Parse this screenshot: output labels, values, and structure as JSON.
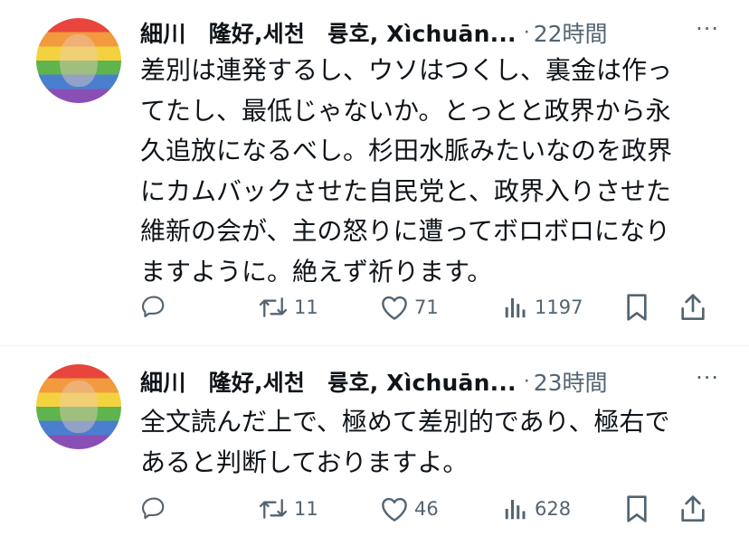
{
  "tweets": [
    {
      "author": "細川　隆好,세천　륭호, Xìchuān...",
      "separator": "·",
      "time": "22時間",
      "more": "···",
      "text": "差別は連発するし、ウソはつくし、裏金は作っ\nてたし、最低じゃないか。とっとと政界から永\n久追放になるべし。杉田水脈みたいなのを政界\nにカムバックさせた自民党と、政界入りさせた\n維新の会が、主の怒りに遭ってボロボロになり\nますように。絶えず祈ります。",
      "actions": {
        "reply": "",
        "retweet": "11",
        "like": "71",
        "views": "1197"
      },
      "icons": [
        "reply-icon",
        "retweet-icon",
        "like-icon",
        "views-icon",
        "bookmark-icon",
        "share-icon"
      ]
    },
    {
      "author": "細川　隆好,세천　륭호, Xìchuān...",
      "separator": "·",
      "time": "23時間",
      "more": "···",
      "text": "全文読んだ上で、極めて差別的であり、極右で\nあると判断しておりますよ。",
      "actions": {
        "reply": "",
        "retweet": "11",
        "like": "46",
        "views": "628"
      },
      "icons": [
        "reply-icon",
        "retweet-icon",
        "like-icon",
        "views-icon",
        "bookmark-icon",
        "share-icon"
      ]
    }
  ],
  "colors": {
    "text": "#0f1419",
    "secondary": "#536471",
    "divider": "#eff3f4"
  }
}
